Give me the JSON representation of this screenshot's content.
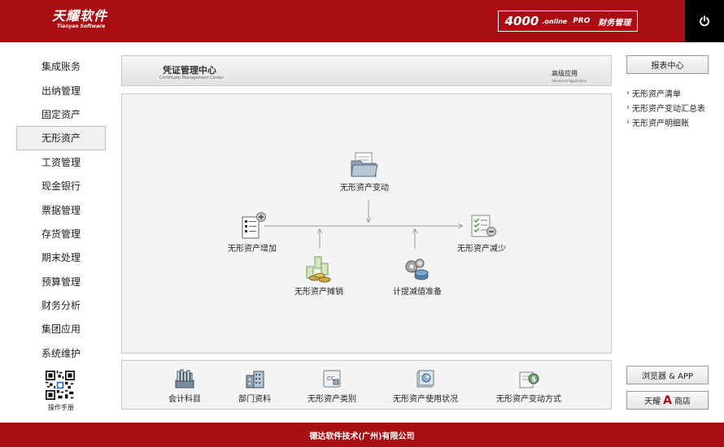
{
  "header": {
    "logo_text": "天耀软件",
    "logo_subtext": "Tianyao Software",
    "product_number": "4000",
    "product_online": ".online",
    "product_edition": "PRO",
    "product_name": "财务管理",
    "brand_color": "#a80e12"
  },
  "nav": {
    "items": [
      {
        "label": "集成账务"
      },
      {
        "label": "出纳管理"
      },
      {
        "label": "固定资产"
      },
      {
        "label": "无形资产",
        "active": true
      },
      {
        "label": "工资管理"
      },
      {
        "label": "现金银行"
      },
      {
        "label": "票据管理"
      },
      {
        "label": "存货管理"
      },
      {
        "label": "期末处理"
      },
      {
        "label": "预算管理"
      },
      {
        "label": "财务分析"
      },
      {
        "label": "集团应用"
      },
      {
        "label": "系统维护"
      }
    ],
    "manual_label": "操作手册"
  },
  "banner": {
    "title": "凭证管理中心",
    "subtitle": "Certificate Management Center",
    "advanced_label": "高级应用",
    "advanced_sublabel": "Advanced Application"
  },
  "workflow": {
    "change": "无形资产变动",
    "add": "无形资产增加",
    "reduce": "无形资产减少",
    "amortize": "无形资产摊销",
    "impairment": "计提减值准备"
  },
  "tools": [
    {
      "label": "会计科目",
      "icon": "ledger-icon"
    },
    {
      "label": "部门资料",
      "icon": "department-icon"
    },
    {
      "label": "无形资产类别",
      "icon": "category-icon"
    },
    {
      "label": "无形资产使用状况",
      "icon": "usage-status-icon"
    },
    {
      "label": "无形资产变动方式",
      "icon": "change-method-icon"
    }
  ],
  "sidebar": {
    "report_center": "报表中心",
    "reports": [
      {
        "label": "无形资产清单"
      },
      {
        "label": "无形资产变动汇总表"
      },
      {
        "label": "无形资产明细账"
      }
    ],
    "browser_app": "浏览器 & APP",
    "store_prefix": "天耀",
    "store_letter": "A",
    "store_suffix": "商店"
  },
  "footer": {
    "company": "德达软件技术(广州)有限公司"
  }
}
